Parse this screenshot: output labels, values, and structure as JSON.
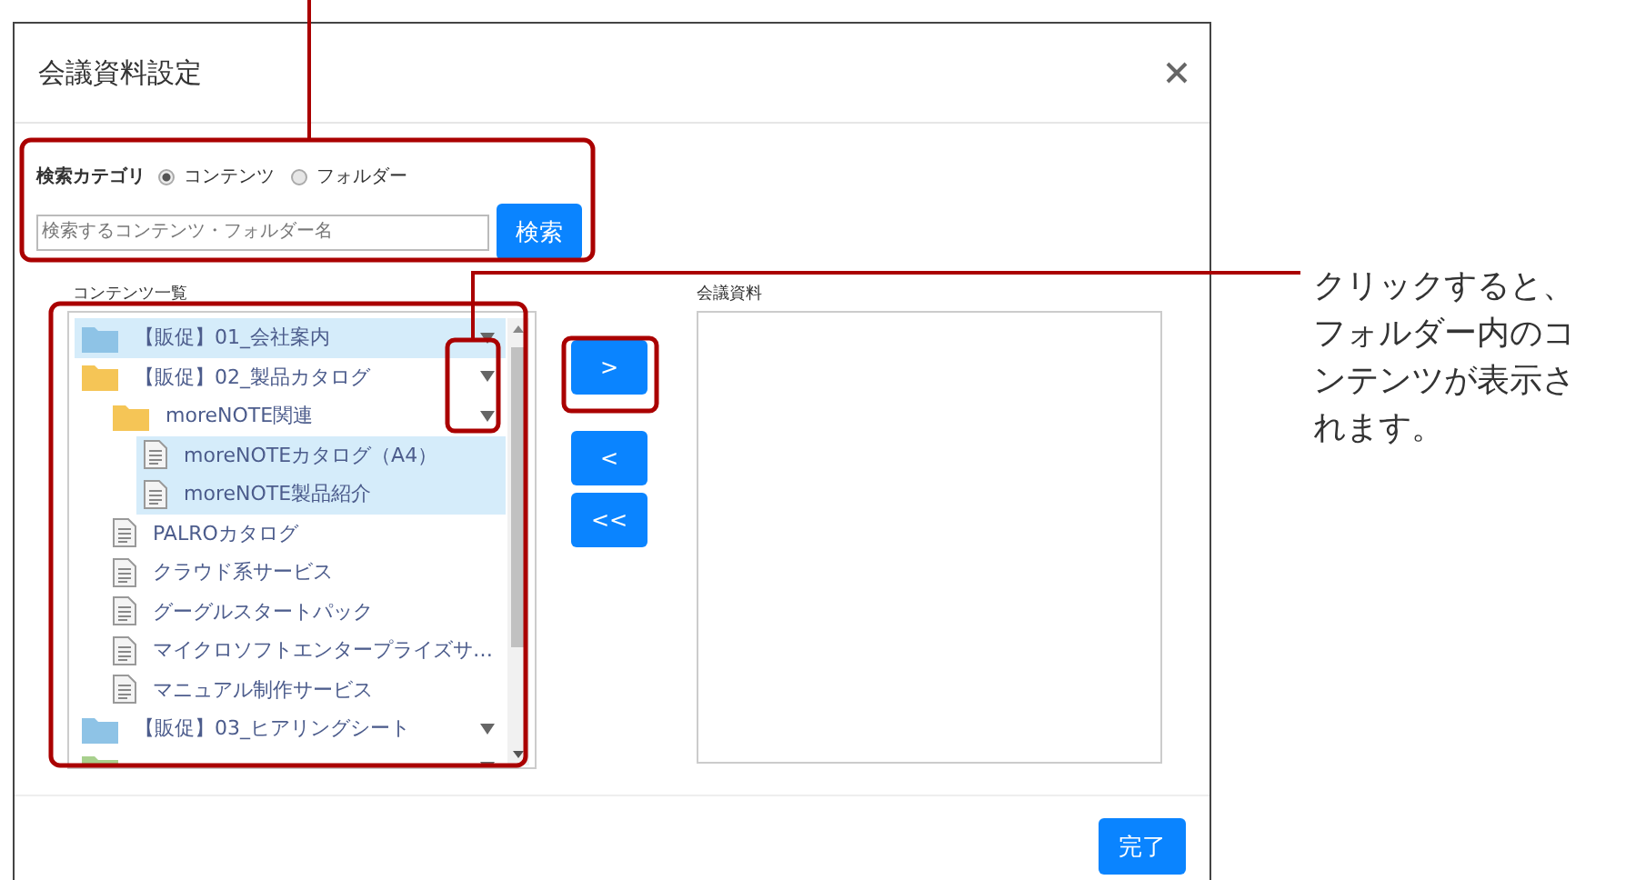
{
  "dialog": {
    "title": "会議資料設定",
    "search": {
      "label": "検索カテゴリ",
      "options": [
        {
          "label": "コンテンツ",
          "selected": true
        },
        {
          "label": "フォルダー",
          "selected": false
        }
      ],
      "placeholder": "検索するコンテンツ・フォルダー名",
      "button": "検索"
    },
    "contents": {
      "label": "コンテンツ一覧",
      "tree": [
        {
          "kind": "folder",
          "label": "【販促】01_会社案内",
          "color": "#8ec3e6",
          "selected": true
        },
        {
          "kind": "folder",
          "label": "【販促】02_製品カタログ",
          "color": "#f5c556",
          "selected": false,
          "children": [
            {
              "kind": "folder",
              "label": "moreNOTE関連",
              "color": "#f5c556",
              "selected": false,
              "children": [
                {
                  "kind": "file",
                  "label": "moreNOTEカタログ（A4）",
                  "selected": true
                },
                {
                  "kind": "file",
                  "label": "moreNOTE製品紹介",
                  "selected": true
                }
              ]
            },
            {
              "kind": "file",
              "label": "PALROカタログ",
              "selected": false
            },
            {
              "kind": "file",
              "label": "クラウド系サービス",
              "selected": false
            },
            {
              "kind": "file",
              "label": "グーグルスタートパック",
              "selected": false
            },
            {
              "kind": "file",
              "label": "マイクロソフトエンタープライズサ…",
              "selected": false
            },
            {
              "kind": "file",
              "label": "マニュアル制作サービス",
              "selected": false
            }
          ]
        },
        {
          "kind": "folder",
          "label": "【販促】03_ヒアリングシート",
          "color": "#8ec3e6",
          "selected": false
        },
        {
          "kind": "folder",
          "color": "#a8d08d",
          "selected": false
        }
      ]
    },
    "transfer_buttons": [
      ">",
      "<",
      "<<"
    ],
    "materials": {
      "label": "会議資料"
    },
    "done_button": "完了"
  },
  "annotation": "クリックすると、フォルダー内のコンテンツが表示されます。"
}
